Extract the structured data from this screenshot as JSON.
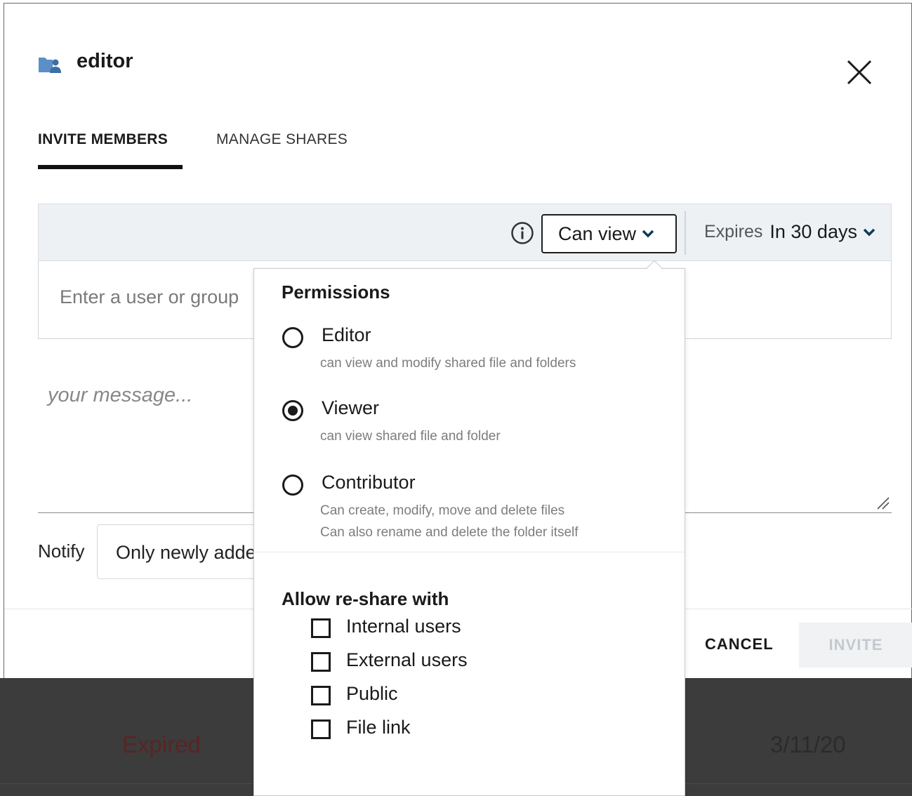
{
  "background": {
    "status_text": "Expired",
    "date_text": "3/11/20"
  },
  "dialog": {
    "title": "editor",
    "header_icon": "shared-folder-icon",
    "tabs": [
      {
        "label": "INVITE MEMBERS",
        "active": true
      },
      {
        "label": "MANAGE SHARES",
        "active": false
      }
    ],
    "permission_button": {
      "label": "Can view",
      "icon": "chevron-down-icon"
    },
    "expires": {
      "label": "Expires",
      "value": "In 30 days"
    },
    "user_input": {
      "placeholder": "Enter a user or group",
      "value": ""
    },
    "message": {
      "placeholder": "your message...",
      "value": ""
    },
    "notify": {
      "label": "Notify",
      "value": "Only newly added"
    },
    "footer": {
      "cancel_label": "CANCEL",
      "invite_label": "INVITE"
    }
  },
  "popover": {
    "permissions_title": "Permissions",
    "options": [
      {
        "label": "Editor",
        "desc": [
          "can view and modify shared file and folders"
        ],
        "checked": false
      },
      {
        "label": "Viewer",
        "desc": [
          "can view shared file and folder"
        ],
        "checked": true
      },
      {
        "label": "Contributor",
        "desc": [
          "Can create, modify, move and delete files",
          "Can also rename and delete the folder itself"
        ],
        "checked": false
      }
    ],
    "reshare_title": "Allow re-share with",
    "reshare": [
      {
        "label": "Internal users",
        "checked": false
      },
      {
        "label": "External users",
        "checked": false
      },
      {
        "label": "Public",
        "checked": false
      },
      {
        "label": "File link",
        "checked": false
      }
    ]
  },
  "colors": {
    "tab_underline": "#111111",
    "perm_bar_bg": "#eef1f4",
    "chevron": "#0e3b5a",
    "folder_icon": "#5b8fc7",
    "invite_disabled_text": "#c4c9ce"
  }
}
